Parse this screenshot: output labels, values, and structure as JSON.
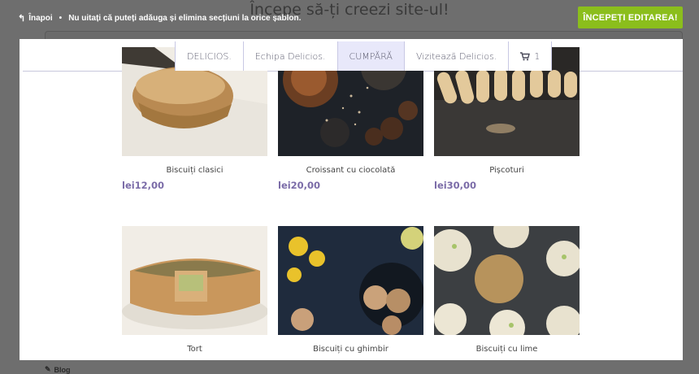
{
  "background": {
    "heading": "Începe să-ți creezi site-ul!",
    "bottom_link": "Blog"
  },
  "topbar": {
    "back_label": "Înapoi",
    "separator": "•",
    "tip": "Nu uitați că puteți adăuga și elimina secțiuni la orice șablon.",
    "start_button": "ÎNCEPEȚI EDITAREA!"
  },
  "nav": {
    "items": [
      {
        "label": "DELICIOS."
      },
      {
        "label": "Echipa Delicios."
      },
      {
        "label": "CUMPĂRĂ"
      },
      {
        "label": "Vizitează Delicios."
      }
    ],
    "cart_count": "1"
  },
  "products": [
    {
      "name": "Biscuiți clasici",
      "price": "lei12,00"
    },
    {
      "name": "Croissant cu ciocolată",
      "price": "lei20,00"
    },
    {
      "name": "Pișcoturi",
      "price": "lei30,00"
    },
    {
      "name": "Tort",
      "price": ""
    },
    {
      "name": "Biscuiți cu ghimbir",
      "price": ""
    },
    {
      "name": "Biscuiți cu lime",
      "price": ""
    }
  ],
  "colors": {
    "accent_green": "#8bbe1c",
    "price_purple": "#7b6ca8",
    "nav_active": "#e8e8fa"
  }
}
